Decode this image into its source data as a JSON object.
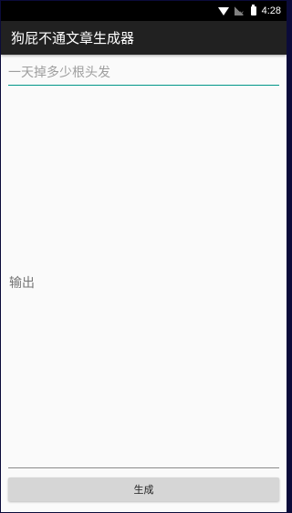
{
  "status_bar": {
    "time": "4:28",
    "icons": [
      "wifi-icon",
      "no-signal-icon",
      "battery-icon"
    ]
  },
  "app_bar": {
    "title": "狗屁不通文章生成器"
  },
  "input": {
    "value": "",
    "placeholder": "一天掉多少根头发"
  },
  "output": {
    "text": "输出"
  },
  "generate_button": {
    "label": "生成"
  },
  "colors": {
    "status_bar": "#000000",
    "app_bar": "#212121",
    "accent": "#009688",
    "background": "#fafafa",
    "button": "#d6d6d6"
  }
}
